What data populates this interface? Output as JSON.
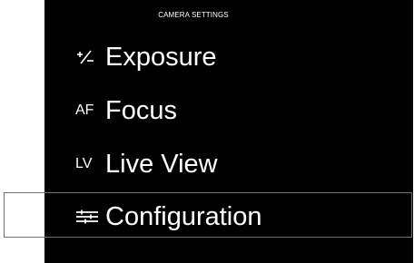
{
  "screen": {
    "title": "CAMERA SETTINGS"
  },
  "menu": {
    "items": [
      {
        "icon": "exposure-compensation-icon",
        "icon_text": "",
        "label": "Exposure"
      },
      {
        "icon": "af-icon",
        "icon_text": "AF",
        "label": "Focus"
      },
      {
        "icon": "lv-icon",
        "icon_text": "LV",
        "label": "Live View"
      },
      {
        "icon": "configuration-icon",
        "icon_text": "",
        "label": "Configuration"
      }
    ],
    "selected": "Configuration"
  },
  "colors": {
    "background": "#000000",
    "text": "#ffffff",
    "selection_border": "#6f6f6f"
  }
}
